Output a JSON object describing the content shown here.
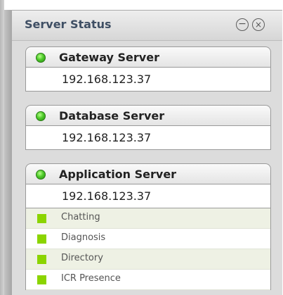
{
  "panel": {
    "title": "Server Status",
    "minimize_icon": "minus-circle-icon",
    "close_icon": "close-circle-icon"
  },
  "servers": [
    {
      "name": "Gateway Server",
      "ip": "192.168.123.37",
      "status": "online",
      "status_color": "#4ecb2a"
    },
    {
      "name": "Database Server",
      "ip": "192.168.123.37",
      "status": "online",
      "status_color": "#4ecb2a"
    },
    {
      "name": "Application Server",
      "ip": "192.168.123.37",
      "status": "online",
      "status_color": "#4ecb2a"
    }
  ],
  "services": [
    {
      "label": "Chatting",
      "status_color": "#8bd400"
    },
    {
      "label": "Diagnosis",
      "status_color": "#8bd400"
    },
    {
      "label": "Directory",
      "status_color": "#8bd400"
    },
    {
      "label": "ICR Presence",
      "status_color": "#8bd400"
    }
  ]
}
